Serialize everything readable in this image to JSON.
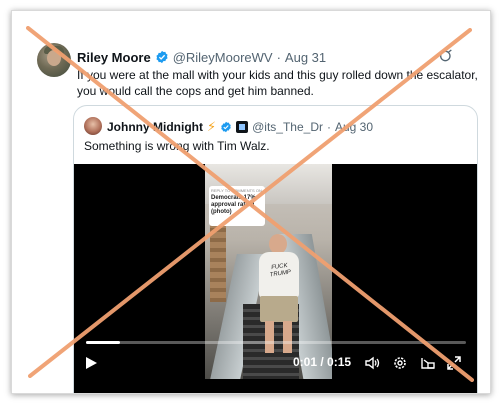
{
  "post": {
    "author_name": "Riley Moore",
    "author_handle": "@RileyMooreWV",
    "separator": "·",
    "date": "Aug 31",
    "text": "If you were at the mall with your kids and this guy rolled down the escalator, you would call the cops and get him banned."
  },
  "quote": {
    "author_name": "Johnny Midnight",
    "author_handle": "@its_The_Dr",
    "separator": "·",
    "date": "Aug 30",
    "text": "Something is wrong with Tim Walz."
  },
  "video": {
    "overlay_header": "REPLY TO COMMENTS ON",
    "overlay_text": "Democrats 17% approval rating (photo)",
    "shirt_text": "FUCK TRUMP",
    "time": "0:01 / 0:15",
    "progress": 0.09
  },
  "icons": {
    "verified": "verified-badge-icon",
    "more": "grok-icon",
    "play": "play-icon",
    "volume": "volume-icon",
    "settings": "settings-icon",
    "pip": "picture-in-picture-icon",
    "fullscreen": "fullscreen-icon"
  },
  "colors": {
    "verified": "#1d9bf0",
    "muted_text": "#536471",
    "cross": "#f0a070"
  }
}
